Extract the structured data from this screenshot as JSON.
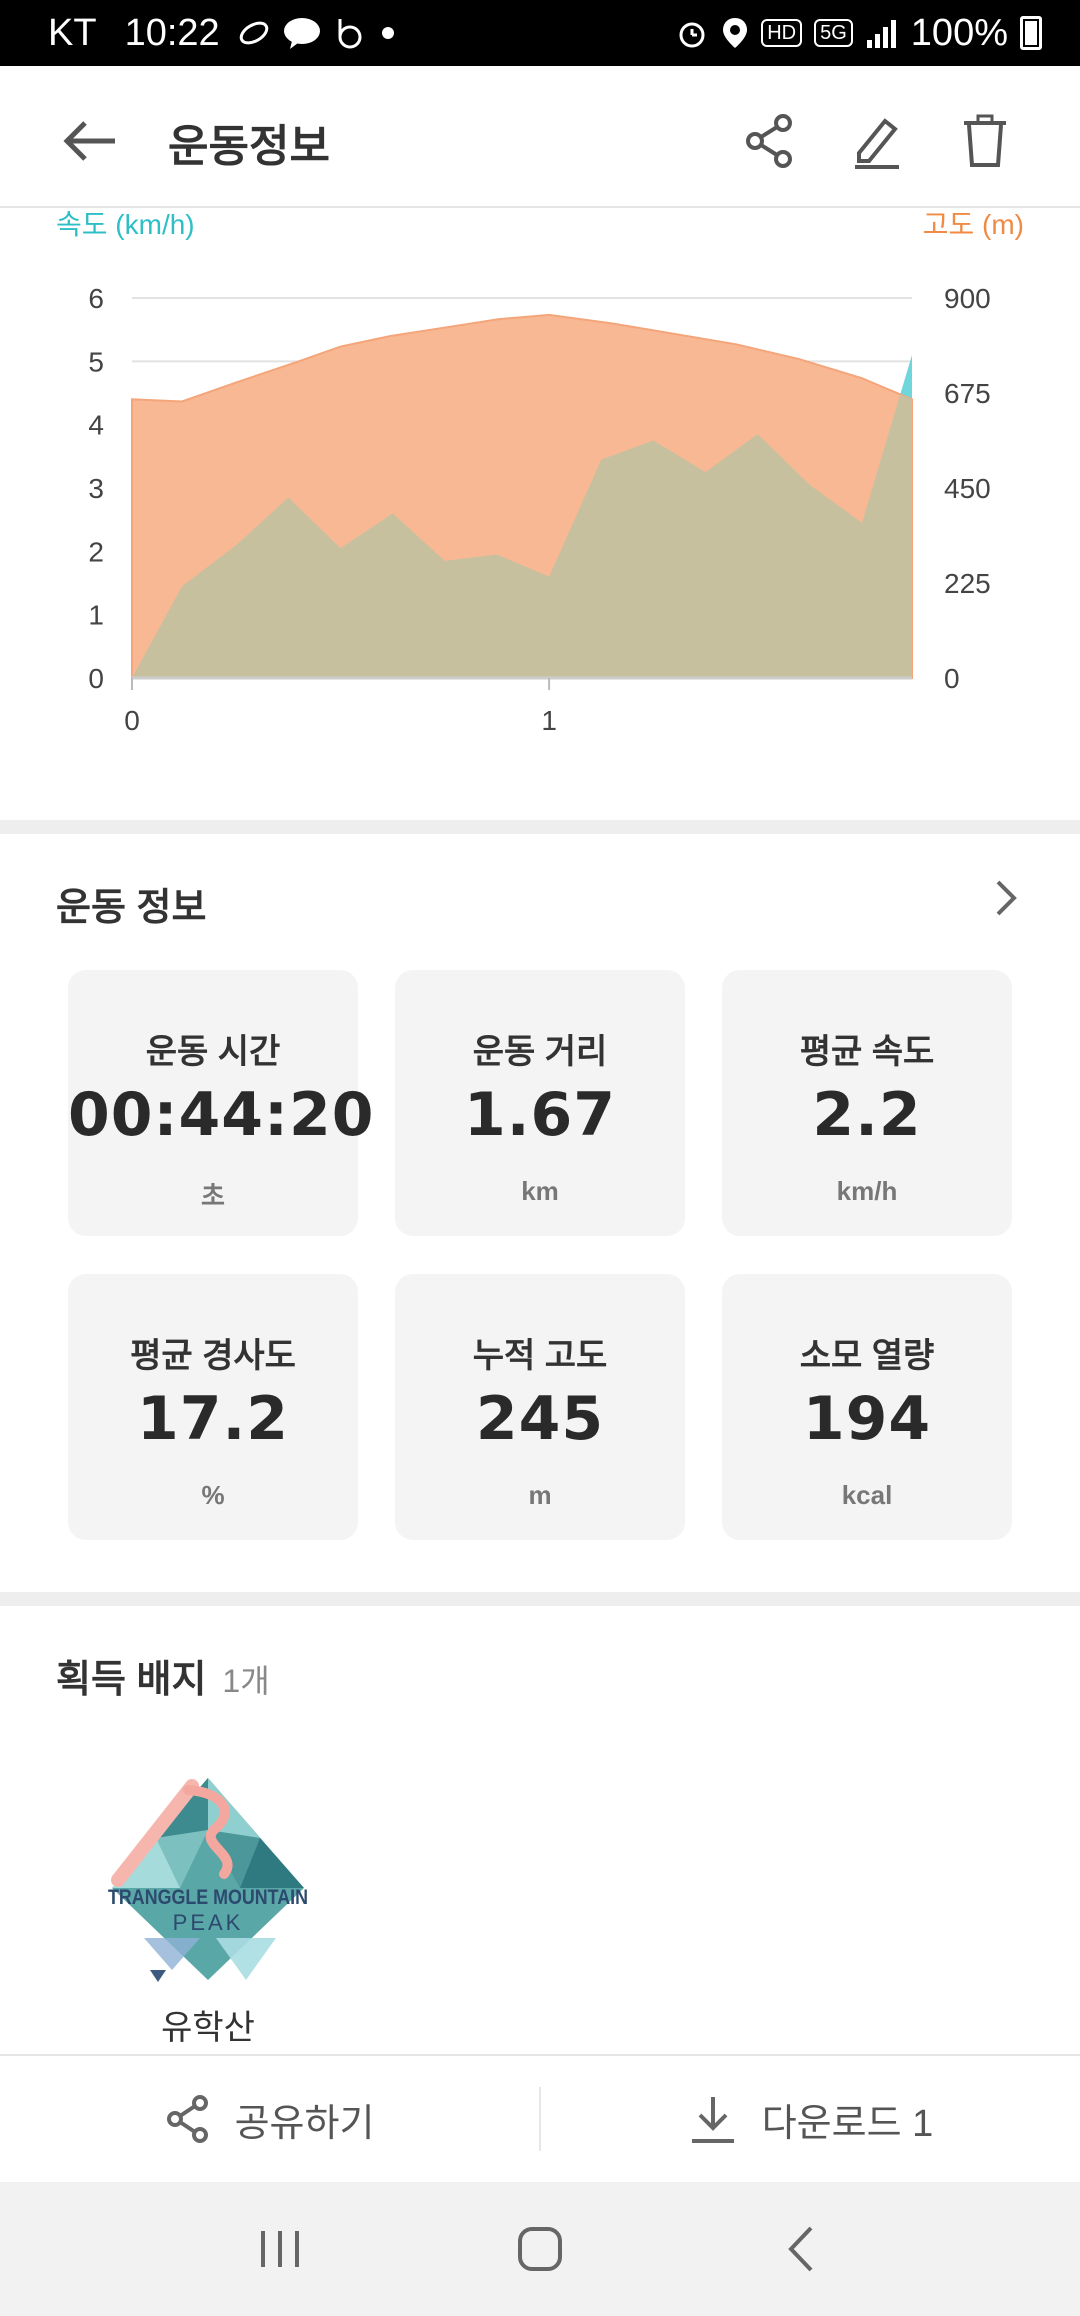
{
  "status_bar": {
    "carrier": "KT",
    "time": "10:22",
    "left_icons": [
      "shoe-icon",
      "talk-icon",
      "b-icon"
    ],
    "right_icons": [
      "alarm-icon",
      "location-icon",
      "hd-icon",
      "5g-icon",
      "signal-icon"
    ],
    "hd_label": "HD",
    "fiveg_label": "5G",
    "battery": "100%"
  },
  "app_bar": {
    "title": "운동정보",
    "icons": [
      "back-arrow-icon",
      "share-icon",
      "edit-icon",
      "trash-icon"
    ]
  },
  "chart_data": {
    "type": "area",
    "left_axis_label": "속도 (km/h)",
    "right_axis_label": "고도 (m)",
    "x_ticks": [
      "0",
      "1"
    ],
    "y_left_ticks": [
      "0",
      "1",
      "2",
      "3",
      "4",
      "5",
      "6"
    ],
    "y_right_ticks": [
      "0",
      "225",
      "450",
      "675",
      "900"
    ],
    "ylim_left": [
      0,
      6
    ],
    "ylim_right": [
      0,
      900
    ],
    "xlim": [
      0,
      1.87
    ],
    "series": [
      {
        "name": "고도 (m)",
        "axis": "right",
        "color": "#f9b894",
        "stroke": "#f4a57a",
        "x": [
          0,
          0.12,
          0.25,
          0.4,
          0.5,
          0.62,
          0.75,
          0.88,
          1.0,
          1.15,
          1.3,
          1.45,
          1.6,
          1.75,
          1.87
        ],
        "values": [
          660,
          655,
          700,
          750,
          785,
          810,
          830,
          850,
          860,
          840,
          815,
          790,
          755,
          710,
          660
        ]
      },
      {
        "name": "속도 (km/h)",
        "axis": "left",
        "color": "#6fd6dc",
        "stroke": "#5bc9d0",
        "x": [
          0,
          0.12,
          0.25,
          0.375,
          0.5,
          0.625,
          0.75,
          0.875,
          1.0,
          1.125,
          1.25,
          1.375,
          1.5,
          1.625,
          1.75,
          1.87
        ],
        "values": [
          0,
          1.45,
          2.1,
          2.85,
          2.05,
          2.6,
          1.85,
          1.95,
          1.6,
          3.45,
          3.75,
          3.25,
          3.85,
          3.05,
          2.45,
          5.1
        ]
      }
    ],
    "grid": true,
    "colors": {
      "left_label": "#2ebfc6",
      "right_label": "#f08a45",
      "overlap": "#c7c09f"
    }
  },
  "stats_section": {
    "title": "운동 정보",
    "cards": [
      {
        "label": "운동 시간",
        "value": "00:44:20",
        "unit": "초"
      },
      {
        "label": "운동 거리",
        "value": "1.67",
        "unit": "km"
      },
      {
        "label": "평균 속도",
        "value": "2.2",
        "unit": "km/h"
      },
      {
        "label": "평균 경사도",
        "value": "17.2",
        "unit": "%"
      },
      {
        "label": "누적 고도",
        "value": "245",
        "unit": "m"
      },
      {
        "label": "소모 열량",
        "value": "194",
        "unit": "kcal"
      }
    ]
  },
  "badges_section": {
    "title": "획득 배지",
    "count": "1개",
    "badges": [
      {
        "name": "유학산",
        "logo_text_1": "TRANGGLE MOUNTAIN",
        "logo_text_2": "PEAK"
      }
    ]
  },
  "action_bar": {
    "share_label": "공유하기",
    "download_label": "다운로드 1"
  },
  "nav_bar": {
    "icons": [
      "recents-icon",
      "home-icon",
      "back-icon"
    ]
  }
}
